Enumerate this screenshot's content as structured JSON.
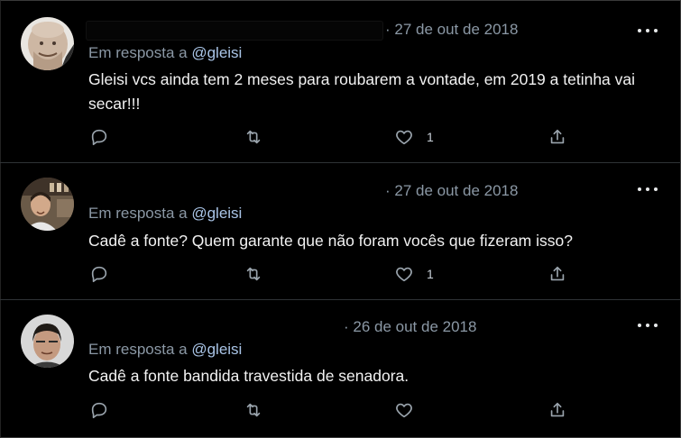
{
  "tweets": [
    {
      "date": "· 27 de out de 2018",
      "reply_prefix": "Em resposta a ",
      "reply_handle": "@gleisi",
      "text": "Gleisi vcs ainda tem 2 meses para roubarem a vontade, em 2019 a tetinha vai secar!!!",
      "reply_count": "",
      "retweet_count": "",
      "like_count": "1",
      "avatar_icon": "user-avatar-bald-man"
    },
    {
      "date": "· 27 de out de 2018",
      "reply_prefix": "Em resposta a ",
      "reply_handle": "@gleisi",
      "text": "Cadê a fonte? Quem garante que não foram vocês que fizeram isso?",
      "reply_count": "",
      "retweet_count": "",
      "like_count": "1",
      "avatar_icon": "user-avatar-man-shelf"
    },
    {
      "date": "· 26 de out de 2018",
      "reply_prefix": "Em resposta a ",
      "reply_handle": "@gleisi",
      "text": "Cadê a fonte bandida travestida de senadora.",
      "reply_count": "",
      "retweet_count": "",
      "like_count": "",
      "avatar_icon": "user-avatar-man-dark-hair"
    }
  ],
  "colors": {
    "background": "#000000",
    "text": "#e7e9ea",
    "muted": "#8b98a5",
    "handle": "#a9c4e6",
    "divider": "#2f3336"
  },
  "icons": [
    "reply-icon",
    "retweet-icon",
    "like-icon",
    "share-icon",
    "more-options-icon"
  ]
}
